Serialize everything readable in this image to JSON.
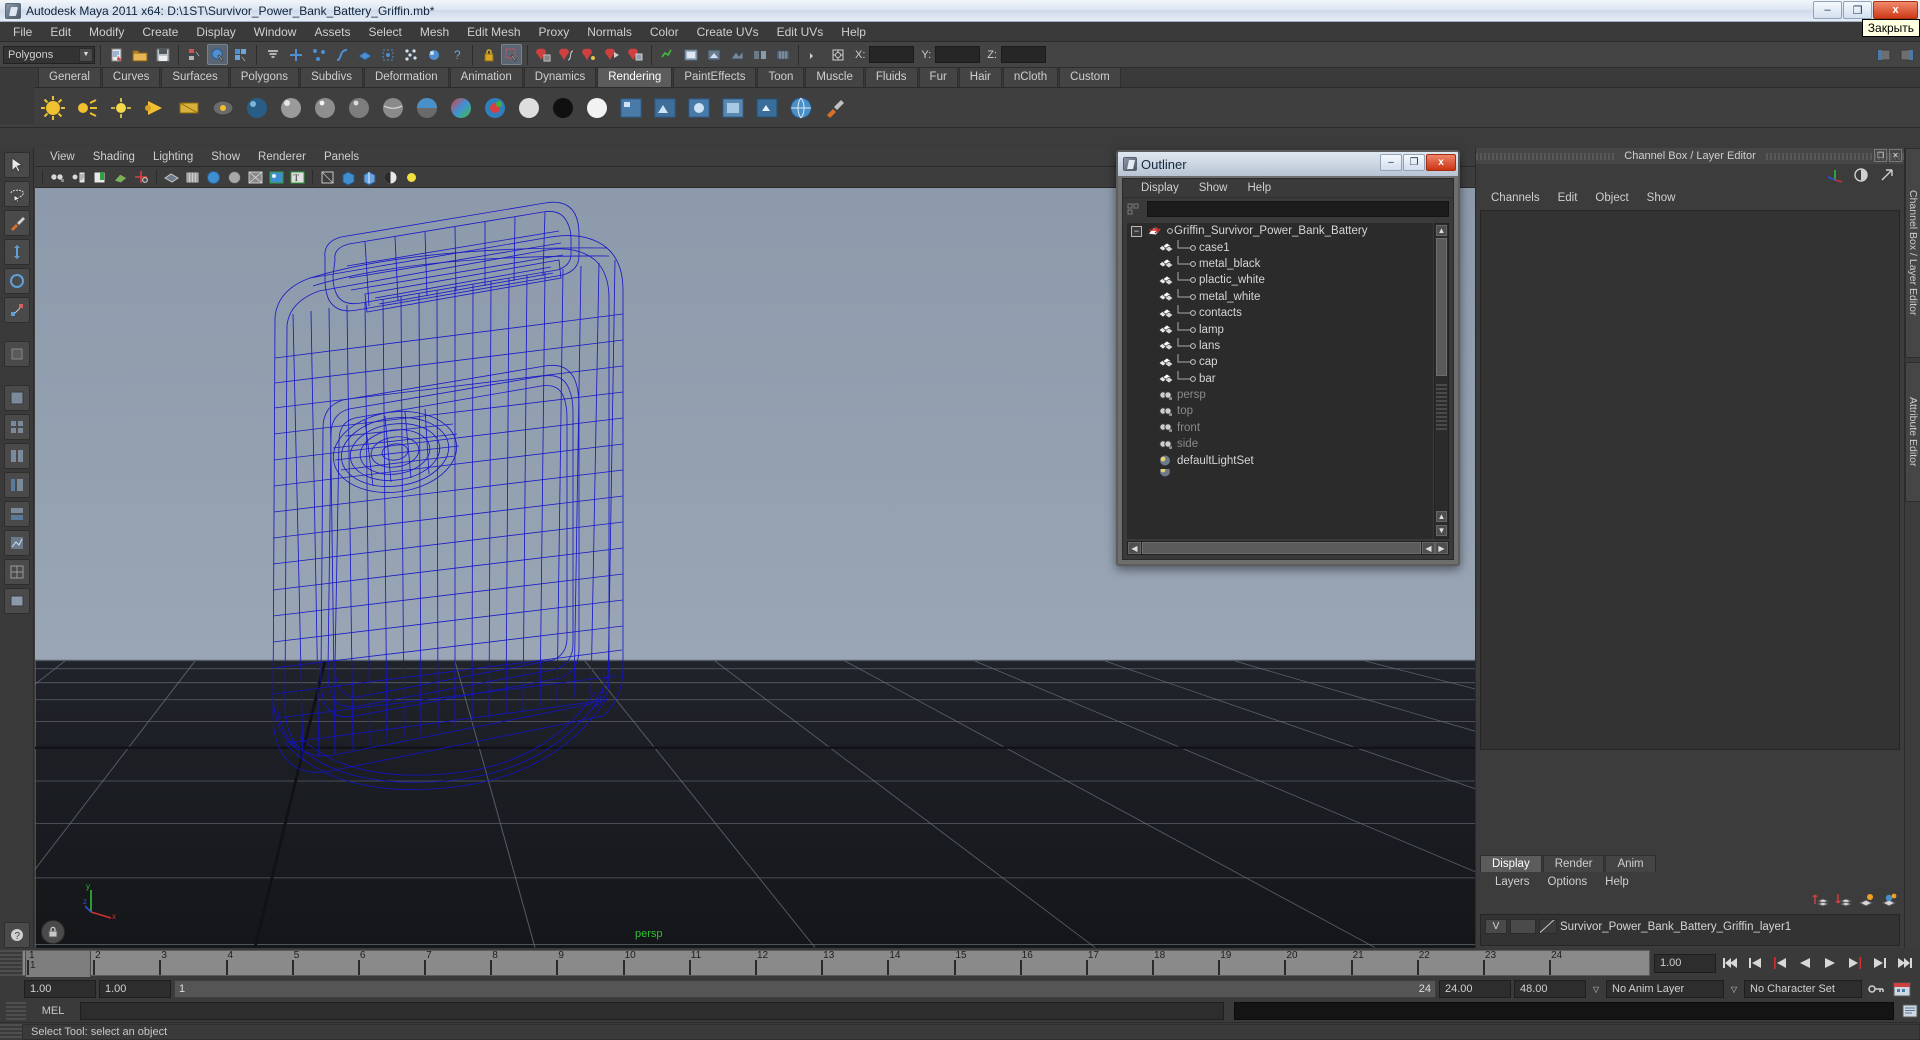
{
  "window": {
    "title": "Autodesk Maya 2011 x64: D:\\1ST\\Survivor_Power_Bank_Battery_Griffin.mb*",
    "minimize": "–",
    "maximize": "❐",
    "close": "x",
    "close_tooltip": "Закрыть"
  },
  "menubar": {
    "items": [
      "File",
      "Edit",
      "Modify",
      "Create",
      "Display",
      "Window",
      "Assets",
      "Select",
      "Mesh",
      "Edit Mesh",
      "Proxy",
      "Normals",
      "Color",
      "Create UVs",
      "Edit UVs",
      "Help"
    ]
  },
  "statusline": {
    "mode_selector": "Polygons",
    "x_label": "X:",
    "y_label": "Y:",
    "z_label": "Z:",
    "x_value": "",
    "y_value": "",
    "z_value": ""
  },
  "shelf": {
    "tabs": [
      "General",
      "Curves",
      "Surfaces",
      "Polygons",
      "Subdivs",
      "Deformation",
      "Animation",
      "Dynamics",
      "Rendering",
      "PaintEffects",
      "Toon",
      "Muscle",
      "Fluids",
      "Fur",
      "Hair",
      "nCloth",
      "Custom"
    ],
    "active_tab": "Rendering"
  },
  "viewport": {
    "menus": [
      "View",
      "Shading",
      "Lighting",
      "Show",
      "Renderer",
      "Panels"
    ],
    "camera_label": "persp",
    "axis_x": "x",
    "axis_y": "y",
    "axis_z": "z"
  },
  "outliner": {
    "title": "Outliner",
    "minimize": "–",
    "maximize": "❐",
    "close": "x",
    "menus": [
      "Display",
      "Show",
      "Help"
    ],
    "search_value": "",
    "root": "Griffin_Survivor_Power_Bank_Battery",
    "children": [
      "case1",
      "metal_black",
      "plactic_white",
      "metal_white",
      "contacts",
      "lamp",
      "lans",
      "cap",
      "bar"
    ],
    "cameras": [
      "persp",
      "top",
      "front",
      "side"
    ],
    "sets": [
      "defaultLightSet"
    ]
  },
  "channel_box": {
    "panel_title": "Channel Box / Layer Editor",
    "restore": "❐",
    "close": "✕",
    "menus": [
      "Channels",
      "Edit",
      "Object",
      "Show"
    ],
    "vertical_tabs": [
      "Channel Box / Layer Editor",
      "Attribute Editor"
    ]
  },
  "layer_editor": {
    "tabs": [
      "Display",
      "Render",
      "Anim"
    ],
    "active_tab": "Display",
    "menus": [
      "Layers",
      "Options",
      "Help"
    ],
    "layers": [
      {
        "visibility": "V",
        "playback": "",
        "name": "Survivor_Power_Bank_Battery_Griffin_layer1"
      }
    ]
  },
  "timeline": {
    "ticks": [
      "1",
      "2",
      "3",
      "4",
      "5",
      "6",
      "7",
      "8",
      "9",
      "10",
      "11",
      "12",
      "13",
      "14",
      "15",
      "16",
      "17",
      "18",
      "19",
      "20",
      "21",
      "22",
      "23",
      "24"
    ],
    "current_frame_label": "1",
    "current_frame_field": "1.00",
    "playback_buttons": [
      "go-to-start",
      "step-back-key",
      "step-back-frame",
      "play-backwards",
      "play-forwards",
      "step-forward-frame",
      "step-forward-key",
      "go-to-end"
    ]
  },
  "range_slider": {
    "start_field": "1.00",
    "anim_start_field": "1.00",
    "range_start": "1",
    "range_end": "24",
    "anim_end_field": "24.00",
    "end_field": "48.00",
    "anim_layer": "No Anim Layer",
    "character_set": "No Character Set"
  },
  "command_line": {
    "language_label": "MEL",
    "input_value": ""
  },
  "help_line": {
    "text": "Select Tool: select an object"
  },
  "colors": {
    "accent_blue": "#1414c8",
    "viewport_sky_top": "#8d9aab",
    "viewport_sky_bottom": "#9aa6b5",
    "viewport_floor": "#1a1d22",
    "panel_bg": "#3c3c3c",
    "active_tab": "#5c5c5c",
    "persp_green": "#2fbf2f"
  }
}
